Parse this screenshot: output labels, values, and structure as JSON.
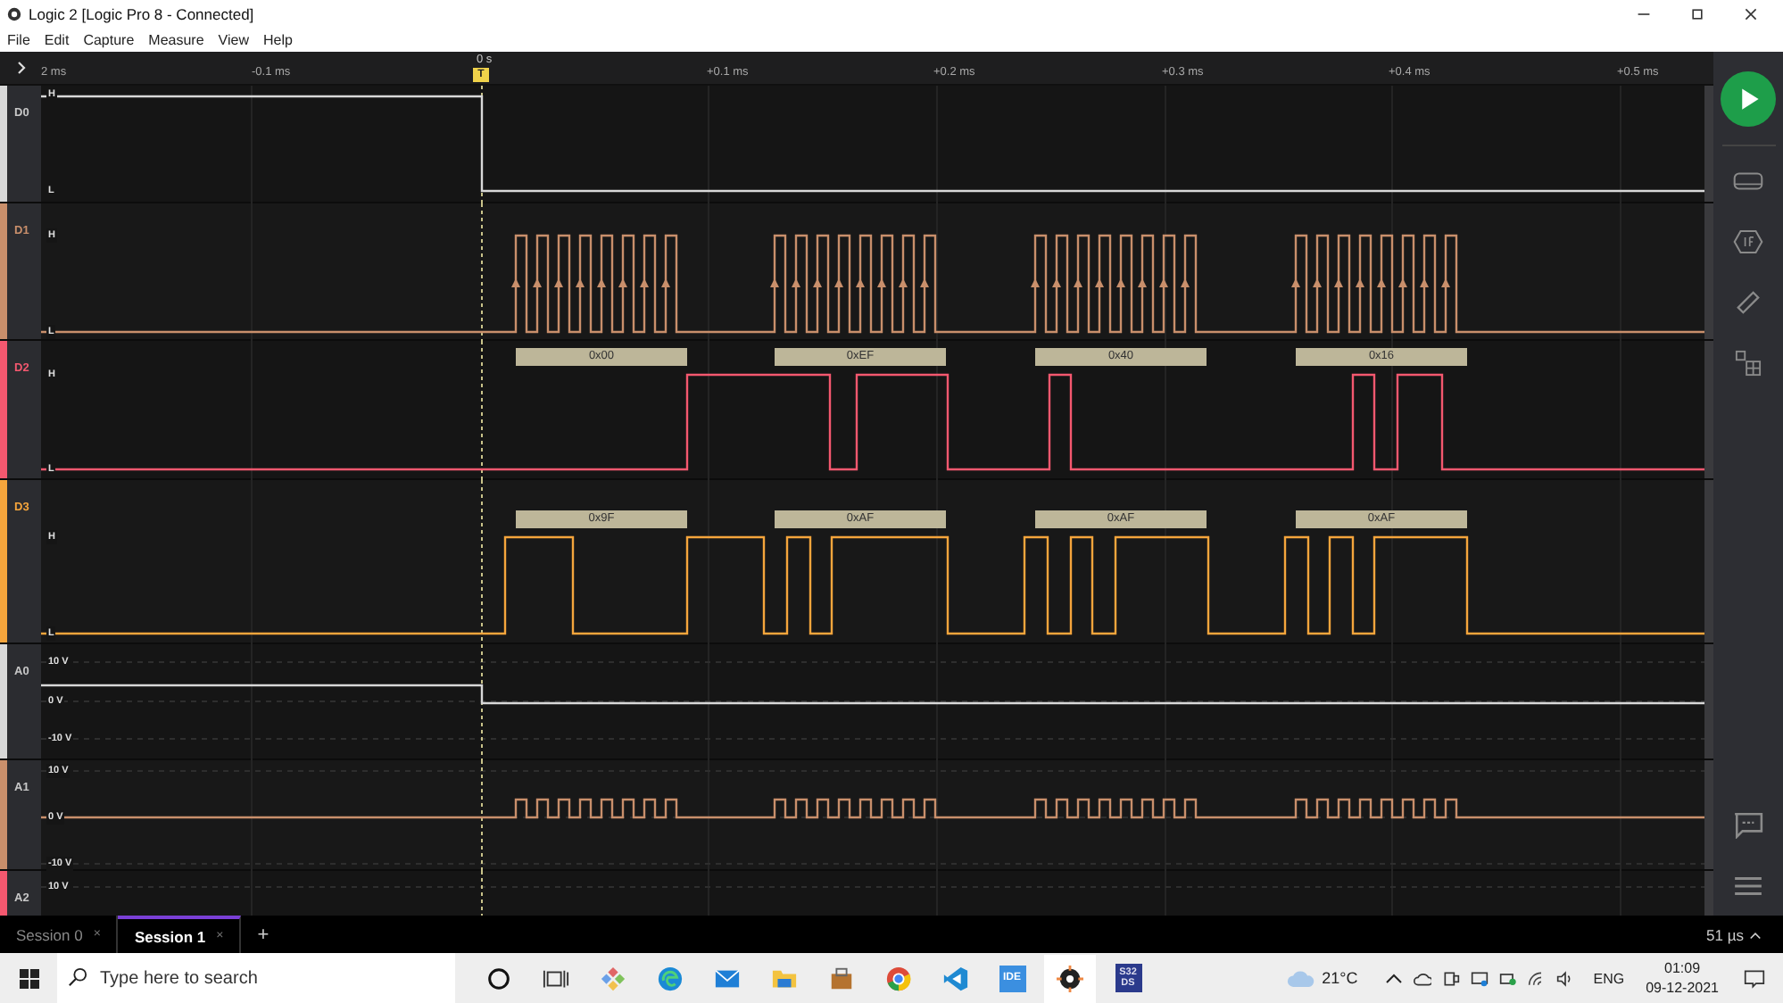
{
  "window": {
    "title": "Logic 2 [Logic Pro 8 - Connected]"
  },
  "menu": [
    "File",
    "Edit",
    "Capture",
    "Measure",
    "View",
    "Help"
  ],
  "ruler": {
    "ticks": [
      "2 ms",
      "-0.1 ms",
      "+0.1 ms",
      "+0.2 ms",
      "+0.3 ms",
      "+0.4 ms",
      "+0.5 ms"
    ],
    "trigger_time": "0 s",
    "trigger_marker": "T"
  },
  "channels": [
    {
      "name": "D0",
      "kind": "digital",
      "color": "#d8d8d8",
      "levels": [
        "H",
        "L"
      ]
    },
    {
      "name": "D1",
      "kind": "digital",
      "color": "#c98f6b",
      "levels": [
        "H",
        "L"
      ]
    },
    {
      "name": "D2",
      "kind": "digital",
      "color": "#f4586f",
      "levels": [
        "H",
        "L"
      ],
      "decodes": [
        "0x00",
        "0xEF",
        "0x40",
        "0x16"
      ]
    },
    {
      "name": "D3",
      "kind": "digital",
      "color": "#f5a53c",
      "levels": [
        "H",
        "L"
      ],
      "decodes": [
        "0x9F",
        "0xAF",
        "0xAF",
        "0xAF"
      ]
    },
    {
      "name": "A0",
      "kind": "analog",
      "color": "#d8d8d8",
      "levels": [
        "10 V",
        "0 V",
        "-10 V"
      ]
    },
    {
      "name": "A1",
      "kind": "analog",
      "color": "#c98f6b",
      "levels": [
        "10 V",
        "0 V",
        "-10 V"
      ]
    },
    {
      "name": "A2",
      "kind": "analog",
      "color": "#f4586f",
      "levels": [
        "10 V"
      ]
    }
  ],
  "sessions": [
    {
      "label": "Session 0",
      "close": "×",
      "selected": false
    },
    {
      "label": "Session 1",
      "close": "×",
      "selected": true
    }
  ],
  "add_session": "+",
  "zoom_readout": "51 µs",
  "taskbar": {
    "search": {
      "placeholder": "Type here to search"
    },
    "ide_icon": "IDE",
    "s32_icon": [
      "S32",
      "DS"
    ],
    "weather": "21°C",
    "language": "ENG",
    "time": "01:09",
    "date": "09-12-2021"
  }
}
